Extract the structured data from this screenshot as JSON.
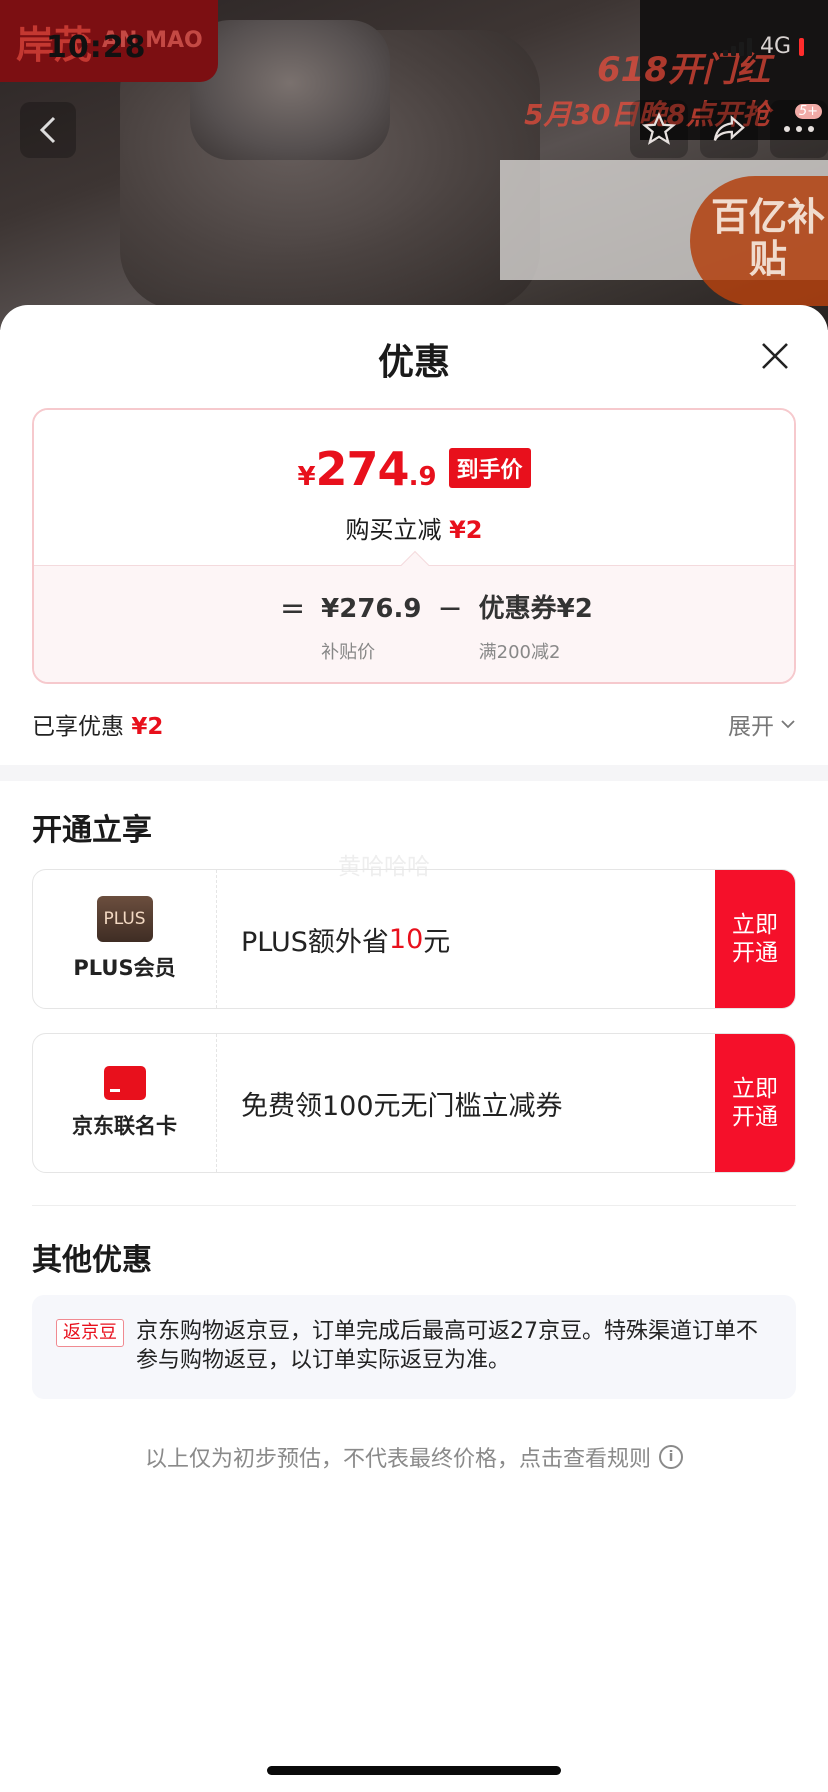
{
  "status_bar": {
    "time": "10:28",
    "network": "4G"
  },
  "hero": {
    "brand_cn": "岸茂",
    "brand_en": "AN MAO",
    "promo_line1": "618开门红",
    "promo_line2": "5月30日晚8点开抢",
    "subsidy_badge": "百亿补贴",
    "notification_count": "5+"
  },
  "sheet": {
    "title": "优惠",
    "price": {
      "yen": "¥",
      "integer": "274",
      "decimal": ".9",
      "tag": "到手价",
      "desc_prefix": "购买立减",
      "desc_amount": "¥2"
    },
    "formula": {
      "eq": "=",
      "subsidy_value": "¥276.9",
      "subsidy_label": "补贴价",
      "minus": "−",
      "coupon_value": "优惠券¥2",
      "coupon_label": "满200减2"
    },
    "enjoyed_label": "已享优惠",
    "enjoyed_amount": "¥2",
    "expand_label": "展开",
    "watermark": "黄哈哈哈",
    "open_section_title": "开通立享",
    "offers": [
      {
        "icon_text": "PLUS",
        "name": "PLUS会员",
        "desc_prefix": "PLUS额外省",
        "desc_amount": "10",
        "desc_suffix": "元",
        "button": "立即开通"
      },
      {
        "name": "京东联名卡",
        "desc": "免费领100元无门槛立减券",
        "button": "立即开通"
      }
    ],
    "other_section_title": "其他优惠",
    "other": {
      "tag": "返京豆",
      "text": "京东购物返京豆，订单完成后最高可返27京豆。特殊渠道订单不参与购物返豆，以订单实际返豆为准。"
    },
    "footer_note": "以上仅为初步预估，不代表最终价格，点击查看规则"
  },
  "colors": {
    "accent_red": "#e8101c",
    "button_red": "#f5102a"
  }
}
